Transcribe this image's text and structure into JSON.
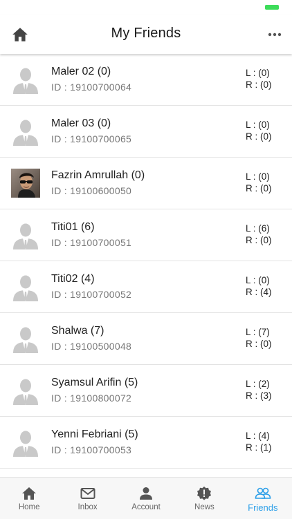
{
  "header": {
    "title": "My Friends"
  },
  "colors": {
    "accent": "#2a9ee8",
    "battery": "#3ddc5a"
  },
  "friends": [
    {
      "name": "Maler 02 (0)",
      "id": "ID : 19100700064",
      "left": "L : (0)",
      "right": "R : (0)",
      "avatar": "default-avatar-icon"
    },
    {
      "name": "Maler 03 (0)",
      "id": "ID : 19100700065",
      "left": "L : (0)",
      "right": "R : (0)",
      "avatar": "default-avatar-icon"
    },
    {
      "name": "Fazrin Amrullah (0)",
      "id": "ID : 19100600050",
      "left": "L : (0)",
      "right": "R : (0)",
      "avatar": "photo"
    },
    {
      "name": "Titi01 (6)",
      "id": "ID : 19100700051",
      "left": "L : (6)",
      "right": "R : (0)",
      "avatar": "default-avatar-icon"
    },
    {
      "name": "Titi02 (4)",
      "id": "ID : 19100700052",
      "left": "L : (0)",
      "right": "R : (4)",
      "avatar": "default-avatar-icon"
    },
    {
      "name": "Shalwa (7)",
      "id": "ID : 19100500048",
      "left": "L : (7)",
      "right": "R : (0)",
      "avatar": "default-avatar-icon"
    },
    {
      "name": "Syamsul Arifin (5)",
      "id": "ID : 19100800072",
      "left": "L : (2)",
      "right": "R : (3)",
      "avatar": "default-avatar-icon"
    },
    {
      "name": "Yenni Febriani (5)",
      "id": "ID : 19100700053",
      "left": "L : (4)",
      "right": "R : (1)",
      "avatar": "default-avatar-icon"
    }
  ],
  "tabs": [
    {
      "label": "Home",
      "icon": "home-icon"
    },
    {
      "label": "Inbox",
      "icon": "mail-icon"
    },
    {
      "label": "Account",
      "icon": "person-icon"
    },
    {
      "label": "News",
      "icon": "badge-alert-icon"
    },
    {
      "label": "Friends",
      "icon": "people-icon",
      "active": true
    }
  ]
}
